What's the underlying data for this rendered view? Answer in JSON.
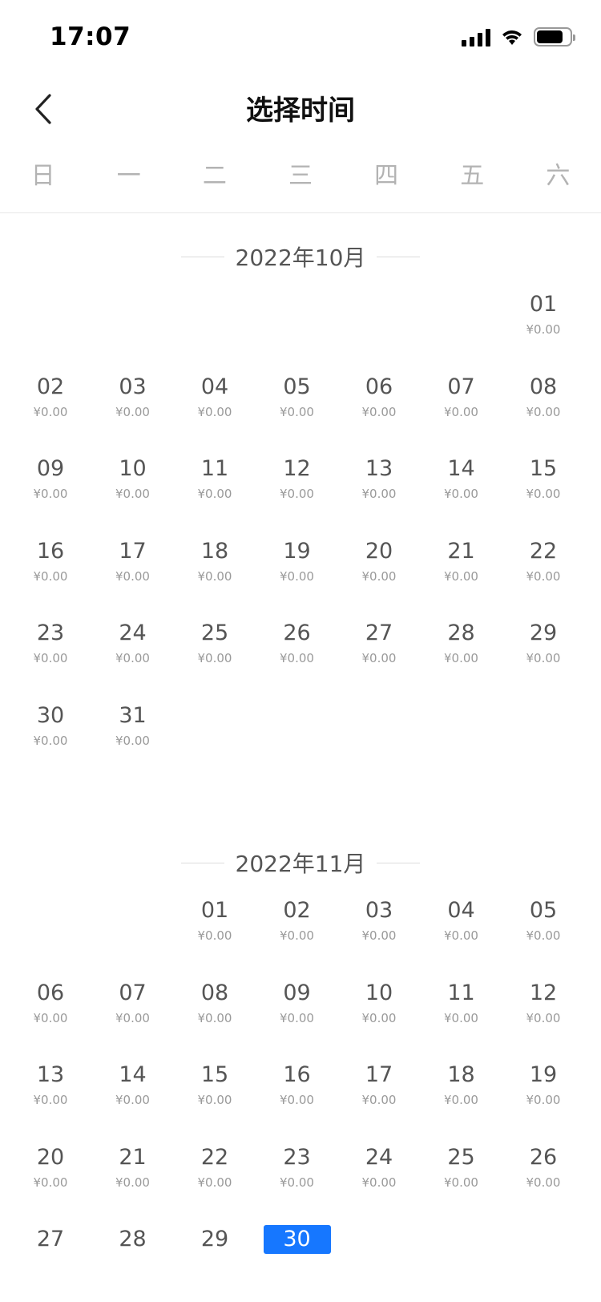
{
  "status_bar": {
    "time": "17:07",
    "icons": [
      "signal-icon",
      "wifi-icon",
      "battery-icon"
    ]
  },
  "header": {
    "title": "选择时间",
    "back_icon": "chevron-left-icon"
  },
  "weekdays": [
    "日",
    "一",
    "二",
    "三",
    "四",
    "五",
    "六"
  ],
  "colors": {
    "accent": "#1677ff",
    "text": "#555555",
    "muted": "#9a9a9a",
    "weekday": "#b3b3b3"
  },
  "months": [
    {
      "title": "2022年10月",
      "first_weekday": 6,
      "days": [
        {
          "day": "01",
          "price": "¥0.00"
        },
        {
          "day": "02",
          "price": "¥0.00"
        },
        {
          "day": "03",
          "price": "¥0.00"
        },
        {
          "day": "04",
          "price": "¥0.00"
        },
        {
          "day": "05",
          "price": "¥0.00"
        },
        {
          "day": "06",
          "price": "¥0.00"
        },
        {
          "day": "07",
          "price": "¥0.00"
        },
        {
          "day": "08",
          "price": "¥0.00"
        },
        {
          "day": "09",
          "price": "¥0.00"
        },
        {
          "day": "10",
          "price": "¥0.00"
        },
        {
          "day": "11",
          "price": "¥0.00"
        },
        {
          "day": "12",
          "price": "¥0.00"
        },
        {
          "day": "13",
          "price": "¥0.00"
        },
        {
          "day": "14",
          "price": "¥0.00"
        },
        {
          "day": "15",
          "price": "¥0.00"
        },
        {
          "day": "16",
          "price": "¥0.00"
        },
        {
          "day": "17",
          "price": "¥0.00"
        },
        {
          "day": "18",
          "price": "¥0.00"
        },
        {
          "day": "19",
          "price": "¥0.00"
        },
        {
          "day": "20",
          "price": "¥0.00"
        },
        {
          "day": "21",
          "price": "¥0.00"
        },
        {
          "day": "22",
          "price": "¥0.00"
        },
        {
          "day": "23",
          "price": "¥0.00"
        },
        {
          "day": "24",
          "price": "¥0.00"
        },
        {
          "day": "25",
          "price": "¥0.00"
        },
        {
          "day": "26",
          "price": "¥0.00"
        },
        {
          "day": "27",
          "price": "¥0.00"
        },
        {
          "day": "28",
          "price": "¥0.00"
        },
        {
          "day": "29",
          "price": "¥0.00"
        },
        {
          "day": "30",
          "price": "¥0.00"
        },
        {
          "day": "31",
          "price": "¥0.00"
        }
      ]
    },
    {
      "title": "2022年11月",
      "first_weekday": 2,
      "days": [
        {
          "day": "01",
          "price": "¥0.00"
        },
        {
          "day": "02",
          "price": "¥0.00"
        },
        {
          "day": "03",
          "price": "¥0.00"
        },
        {
          "day": "04",
          "price": "¥0.00"
        },
        {
          "day": "05",
          "price": "¥0.00"
        },
        {
          "day": "06",
          "price": "¥0.00"
        },
        {
          "day": "07",
          "price": "¥0.00"
        },
        {
          "day": "08",
          "price": "¥0.00"
        },
        {
          "day": "09",
          "price": "¥0.00"
        },
        {
          "day": "10",
          "price": "¥0.00"
        },
        {
          "day": "11",
          "price": "¥0.00"
        },
        {
          "day": "12",
          "price": "¥0.00"
        },
        {
          "day": "13",
          "price": "¥0.00"
        },
        {
          "day": "14",
          "price": "¥0.00"
        },
        {
          "day": "15",
          "price": "¥0.00"
        },
        {
          "day": "16",
          "price": "¥0.00"
        },
        {
          "day": "17",
          "price": "¥0.00"
        },
        {
          "day": "18",
          "price": "¥0.00"
        },
        {
          "day": "19",
          "price": "¥0.00"
        },
        {
          "day": "20",
          "price": "¥0.00"
        },
        {
          "day": "21",
          "price": "¥0.00"
        },
        {
          "day": "22",
          "price": "¥0.00"
        },
        {
          "day": "23",
          "price": "¥0.00"
        },
        {
          "day": "24",
          "price": "¥0.00"
        },
        {
          "day": "25",
          "price": "¥0.00"
        },
        {
          "day": "26",
          "price": "¥0.00"
        },
        {
          "day": "27",
          "price": ""
        },
        {
          "day": "28",
          "price": ""
        },
        {
          "day": "29",
          "price": ""
        },
        {
          "day": "30",
          "price": "",
          "selected": true
        }
      ]
    }
  ]
}
